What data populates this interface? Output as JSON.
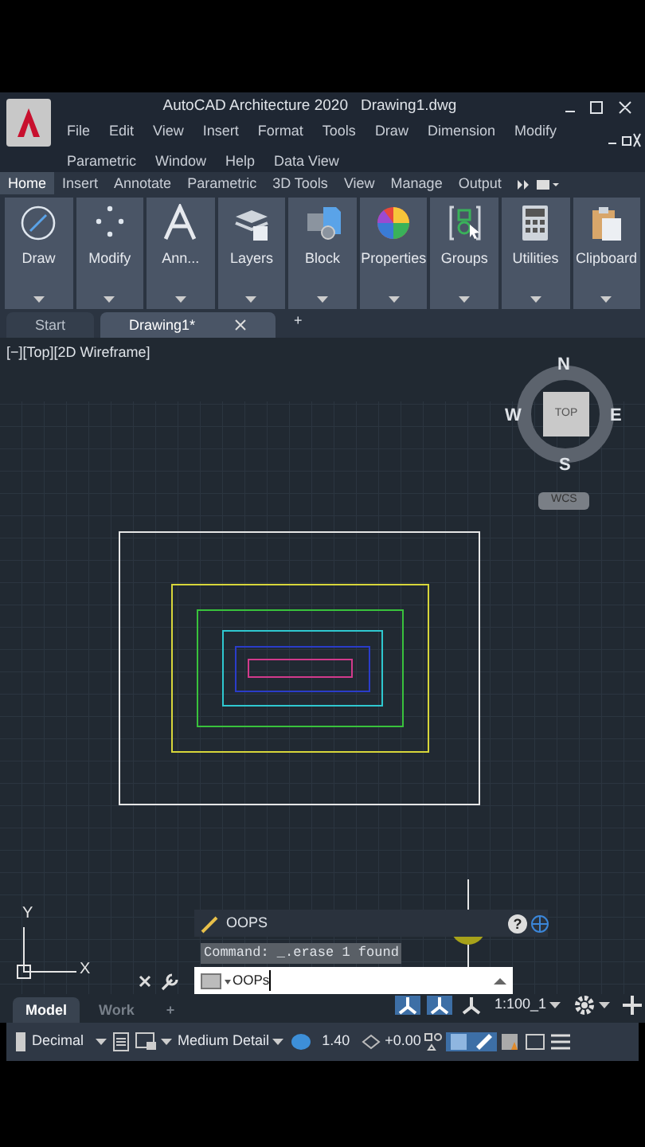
{
  "window": {
    "title": "AutoCAD Architecture 2020",
    "document": "Drawing1.dwg"
  },
  "menu": [
    "File",
    "Edit",
    "View",
    "Insert",
    "Format",
    "Tools",
    "Draw",
    "Dimension",
    "Modify",
    "Parametric",
    "Window",
    "Help",
    "Data View"
  ],
  "ribbon_tabs": [
    {
      "label": "Home",
      "selected": true
    },
    {
      "label": "Insert",
      "selected": false
    },
    {
      "label": "Annotate",
      "selected": false
    },
    {
      "label": "Parametric",
      "selected": false
    },
    {
      "label": "3D Tools",
      "selected": false
    },
    {
      "label": "View",
      "selected": false
    },
    {
      "label": "Manage",
      "selected": false
    },
    {
      "label": "Output",
      "selected": false
    }
  ],
  "panels": [
    {
      "label": "Draw",
      "kind": "draw"
    },
    {
      "label": "Modify",
      "kind": "modify"
    },
    {
      "label": "Ann...",
      "kind": "annotate"
    },
    {
      "label": "Layers",
      "kind": "layers"
    },
    {
      "label": "Block",
      "kind": "block"
    },
    {
      "label": "Properties",
      "kind": "properties"
    },
    {
      "label": "Groups",
      "kind": "groups"
    },
    {
      "label": "Utilities",
      "kind": "utilities"
    },
    {
      "label": "Clipboard",
      "kind": "clipboard"
    }
  ],
  "new_tab": "+",
  "help": "?",
  "add_layout": "+",
  "doc_tabs": [
    {
      "label": "Start",
      "selected": false
    },
    {
      "label": "Drawing1*",
      "selected": true
    }
  ],
  "viewport": {
    "label": "[−][Top][2D Wireframe]",
    "compass": {
      "n": "N",
      "e": "E",
      "s": "S",
      "w": "W",
      "face": "TOP",
      "ucs": "WCS"
    },
    "axis_y": "Y",
    "axis_x": "X"
  },
  "command": {
    "last": "OOPS",
    "history": "Command: _.erase 1 found",
    "input": "OOPs"
  },
  "layout_tabs": [
    {
      "label": "Model",
      "selected": true
    },
    {
      "label": "Work",
      "selected": false
    }
  ],
  "scale": "1:100_1",
  "status": {
    "units": "Decimal",
    "detail": "Medium Detail",
    "cut_plane": "1.40",
    "elevation": "+0.00"
  }
}
